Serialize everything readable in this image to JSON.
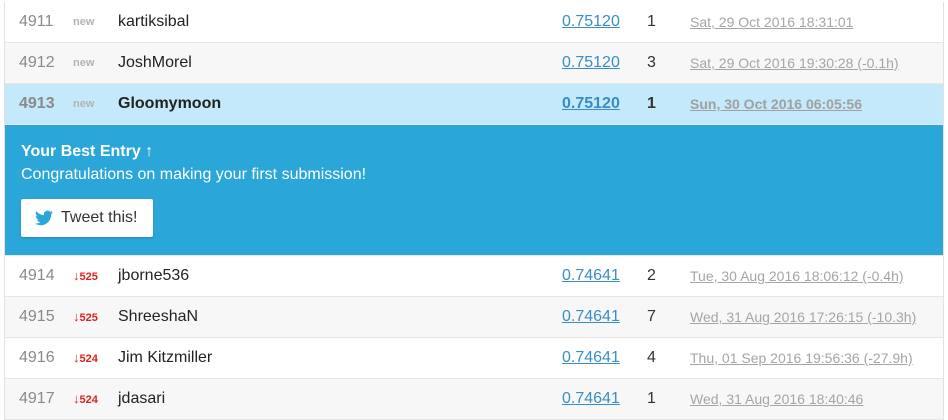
{
  "rows_top": [
    {
      "rank": "4911",
      "delta": "new",
      "team": "kartiksibal",
      "score": "0.75120",
      "entries": "1",
      "last": "Sat, 29 Oct 2016 18:31:01"
    },
    {
      "rank": "4912",
      "delta": "new",
      "team": "JoshMorel",
      "score": "0.75120",
      "entries": "3",
      "last": "Sat, 29 Oct 2016 19:30:28 (-0.1h)"
    },
    {
      "rank": "4913",
      "delta": "new",
      "team": "Gloomymoon",
      "score": "0.75120",
      "entries": "1",
      "last": "Sun, 30 Oct 2016 06:05:56"
    }
  ],
  "banner": {
    "title": "Your Best Entry ↑",
    "subtitle": "Congratulations on making your first submission!",
    "tweet_label": "Tweet this!"
  },
  "rows_bottom": [
    {
      "rank": "4914",
      "arrow": "↓",
      "delta": "525",
      "team": "jborne536",
      "score": "0.74641",
      "entries": "2",
      "last": "Tue, 30 Aug 2016 18:06:12 (-0.4h)"
    },
    {
      "rank": "4915",
      "arrow": "↓",
      "delta": "525",
      "team": "ShreeshaN",
      "score": "0.74641",
      "entries": "7",
      "last": "Wed, 31 Aug 2016 17:26:15 (-10.3h)"
    },
    {
      "rank": "4916",
      "arrow": "↓",
      "delta": "524",
      "team": "Jim Kitzmiller",
      "score": "0.74641",
      "entries": "4",
      "last": "Thu, 01 Sep 2016 19:56:36 (-27.9h)"
    },
    {
      "rank": "4917",
      "arrow": "↓",
      "delta": "524",
      "team": "jdasari",
      "score": "0.74641",
      "entries": "1",
      "last": "Wed, 31 Aug 2016 18:40:46"
    }
  ],
  "colors": {
    "highlight_row": "#c3e9fa",
    "banner_bg": "#2aa6d8",
    "score_link": "#3a8dc4",
    "delta_down": "#e02020"
  },
  "icons": {
    "tweet": "twitter-bird-icon"
  }
}
